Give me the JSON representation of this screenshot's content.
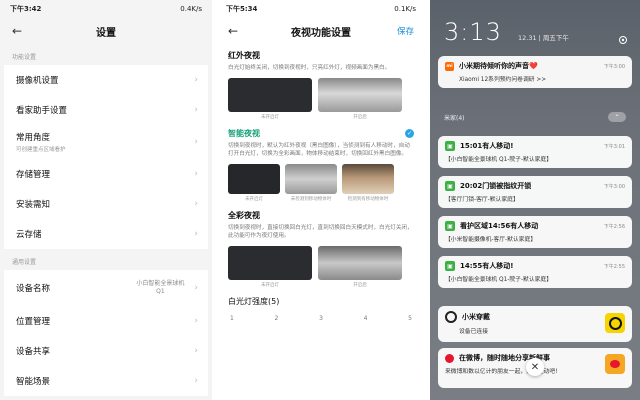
{
  "settings": {
    "status": {
      "time": "下午3:42",
      "speed": "0.4K/s"
    },
    "header": {
      "back_icon": "back-arrow-icon",
      "title": "设置"
    },
    "section_function": "功能设置",
    "items_function": [
      {
        "label": "摄像机设置"
      },
      {
        "label": "看家助手设置"
      },
      {
        "label": "常用角度",
        "sub": "可创建重点区域看护"
      },
      {
        "label": "存储管理"
      },
      {
        "label": "安装需知"
      },
      {
        "label": "云存储"
      }
    ],
    "section_general": "通用设置",
    "items_general": [
      {
        "label": "设备名称",
        "value": "小白智能全景球机 Q1"
      },
      {
        "label": "位置管理"
      },
      {
        "label": "设备共享"
      },
      {
        "label": "智能场景"
      }
    ]
  },
  "night": {
    "status": {
      "time": "下午5:34",
      "speed": "0.1K/s"
    },
    "header": {
      "title": "夜视功能设置",
      "save": "保存"
    },
    "infrared": {
      "label": "红外夜视",
      "desc": "白光灯始终关闭，切换到夜视时，只亮红外灯，视频画面为黑白。",
      "captions": [
        "未开启灯",
        "开启后"
      ]
    },
    "smart": {
      "label": "智能夜视",
      "desc": "切换到夜视时，默认为红外夜视（黑白图像），当侦测到有人移动时，自动打开白光灯，切换为全彩画面，物体移动结束时，切换回红外黑白图像。",
      "captions": [
        "未开启灯",
        "未检测到移动物体时",
        "检测到有移动物体时"
      ]
    },
    "color": {
      "label": "全彩夜视",
      "desc": "切换到夜视时，直接切换回白光灯，直到切换回白天模式时，白光灯关闭，此功能可作为夜灯使用。",
      "captions": [
        "未开启灯",
        "开启后"
      ]
    },
    "intensity": {
      "label": "白光灯强度(5)",
      "ticks": [
        "1",
        "2",
        "3",
        "4",
        "5"
      ]
    }
  },
  "lock": {
    "time": "3:13",
    "date": "12.31 | 周五下午",
    "notifications": [
      {
        "title": "小米期待倾听你的声音❤️",
        "body": "Xiaomi 12系列预约问卷调研 >>",
        "time": "下午3:00"
      }
    ],
    "group_label": "米家(4)",
    "group_notifications": [
      {
        "title": "15:01有人移动!",
        "body": "【小白智能全景球机 Q1-院子-默认家庭】",
        "time": "下午3:01"
      },
      {
        "title": "20:02门锁被指纹开锁",
        "body": "【客厅门锁-客厅-默认家庭】",
        "time": "下午3:00"
      },
      {
        "title": "看护区域14:56有人移动",
        "body": "【小米智能摄像机-客厅-默认家庭】",
        "time": "下午2:56"
      },
      {
        "title": "14:55有人移动!",
        "body": "【小白智能全景球机 Q1-院子-默认家庭】",
        "time": "下午2:55"
      }
    ],
    "app_notifications": [
      {
        "title": "小米穿戴",
        "body": "设备已连接"
      },
      {
        "title": "在微博，随时随地分享新鲜事",
        "body": "来微博和数以亿计的朋友一起，分享互动吧!"
      }
    ]
  }
}
